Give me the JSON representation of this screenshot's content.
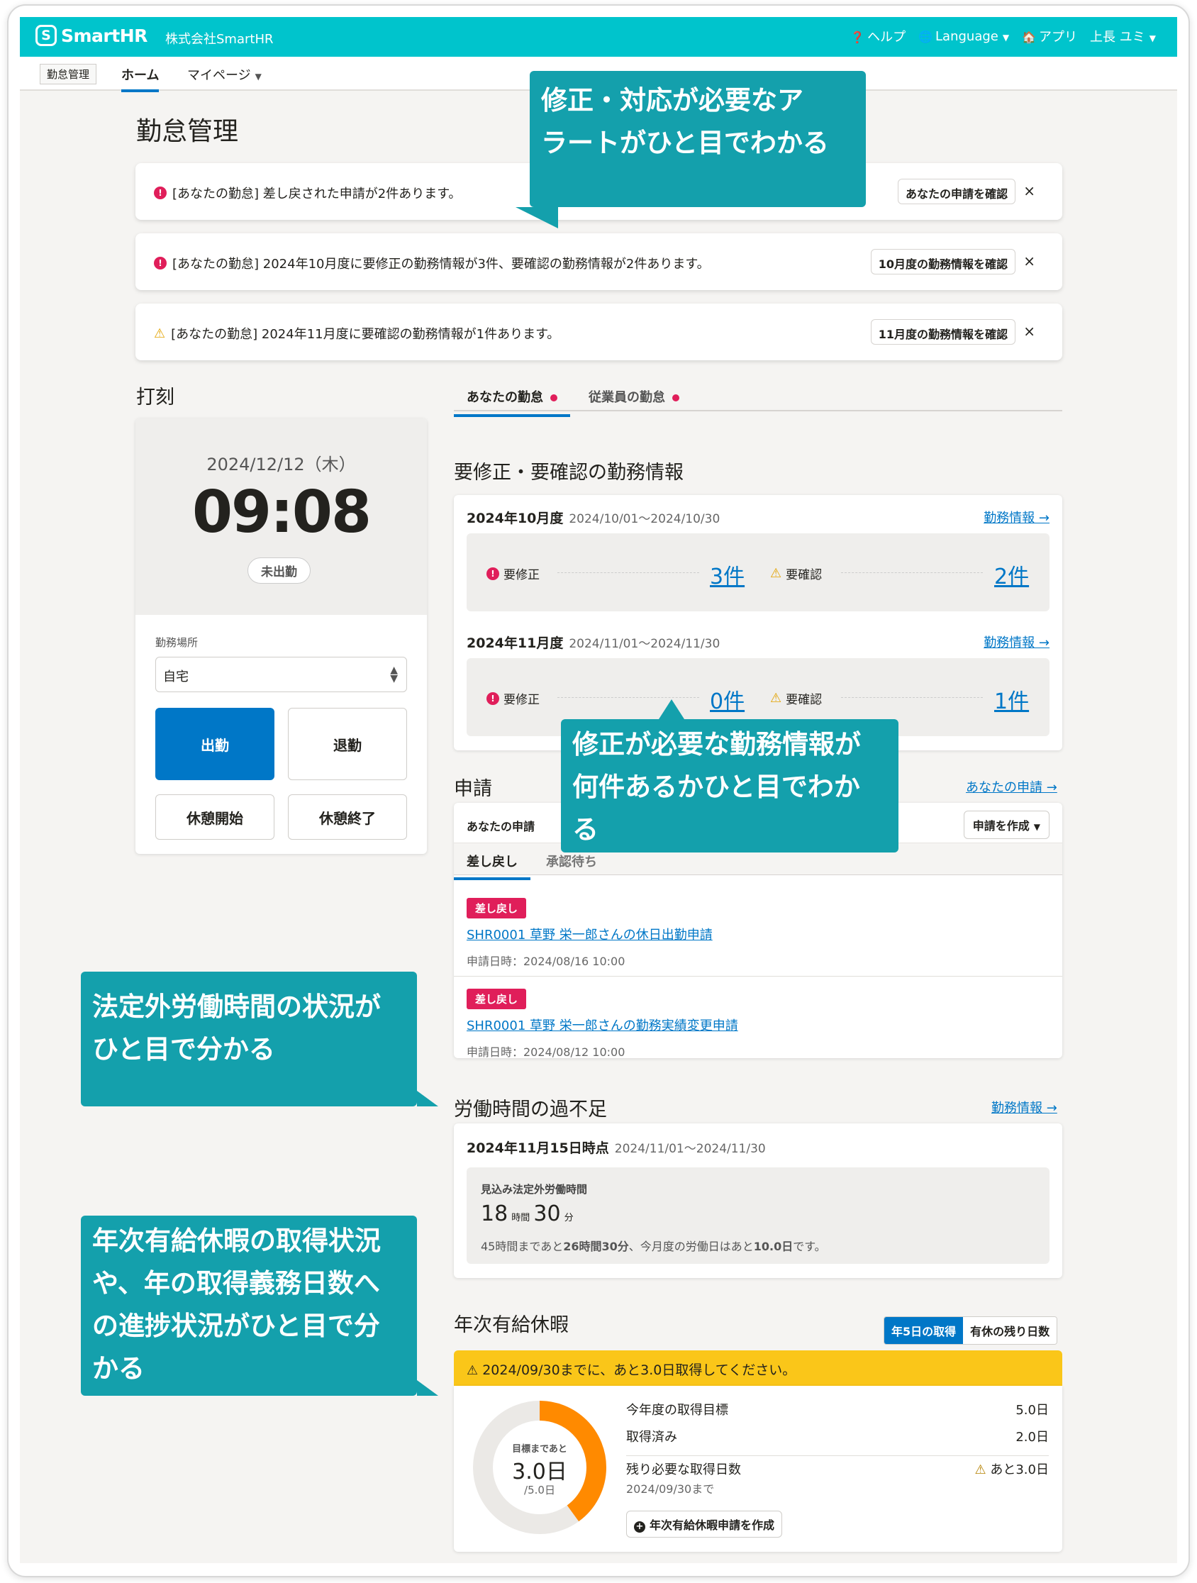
{
  "topbar": {
    "logo_text": "SmartHR",
    "company": "株式会社SmartHR",
    "help": "ヘルプ",
    "language": "Language",
    "apps": "アプリ",
    "user": "上長 ユミ",
    "bg_color": "#00c4cc"
  },
  "subnav": {
    "product": "勤怠管理",
    "home": "ホーム",
    "mypage": "マイページ"
  },
  "page_title": "勤怠管理",
  "alerts": [
    {
      "icon": "error",
      "text": "[あなたの勤怠] 差し戻された申請が2件あります。",
      "button": "あなたの申請を確認",
      "close": "×"
    },
    {
      "icon": "error",
      "text": "[あなたの勤怠] 2024年10月度に要修正の勤務情報が3件、要確認の勤務情報が2件あります。",
      "button": "10月度の勤務情報を確認",
      "close": "×"
    },
    {
      "icon": "warning",
      "text": "[あなたの勤怠] 2024年11月度に要確認の勤務情報が1件あります。",
      "button": "11月度の勤務情報を確認",
      "close": "×"
    }
  ],
  "punch": {
    "title": "打刻",
    "date": "2024/12/12（木）",
    "time": "09:08",
    "status": "未出勤",
    "location_label": "勤務場所",
    "location_value": "自宅",
    "clock_in": "出勤",
    "clock_out": "退勤",
    "break_start": "休憩開始",
    "break_end": "休憩終了"
  },
  "tabs": {
    "mine": "あなたの勤怠",
    "employees": "従業員の勤怠"
  },
  "fix_section": {
    "title": "要修正・要確認の勤務情報",
    "periods": [
      {
        "label": "2024年10月度",
        "range": "2024/10/01〜2024/10/30",
        "link": "勤務情報 →",
        "fix_label": "要修正",
        "fix_count": "3件",
        "check_label": "要確認",
        "check_count": "2件"
      },
      {
        "label": "2024年11月度",
        "range": "2024/11/01〜2024/11/30",
        "link": "勤務情報 →",
        "fix_label": "要修正",
        "fix_count": "0件",
        "check_label": "要確認",
        "check_count": "1件"
      }
    ]
  },
  "requests": {
    "title": "申請",
    "link": "あなたの申請 →",
    "header_label": "あなたの申請",
    "create_button": "申請を作成",
    "tab_returned": "差し戻し",
    "tab_pending": "承認待ち",
    "items": [
      {
        "badge": "差し戻し",
        "title": "SHR0001 草野 栄一郎さんの休日出勤申請",
        "date": "申請日時：2024/08/16 10:00"
      },
      {
        "badge": "差し戻し",
        "title": "SHR0001 草野 栄一郎さんの勤務実績変更申請",
        "date": "申請日時：2024/08/12 10:00"
      }
    ]
  },
  "overtime": {
    "title": "労働時間の過不足",
    "link": "勤務情報 →",
    "as_of": "2024年11月15日時点",
    "range": "2024/11/01〜2024/11/30",
    "box_label": "見込み法定外労働時間",
    "hours": "18",
    "hours_unit": "時間",
    "minutes": "30",
    "minutes_unit": "分",
    "note_pre": "45時間まであと",
    "note_bold1": "26時間30分",
    "note_mid": "、今月度の労働日はあと",
    "note_bold2": "10.0日",
    "note_post": "です。"
  },
  "leave": {
    "title": "年次有給休暇",
    "seg_on": "年5日の取得",
    "seg_off": "有休の残り日数",
    "banner": "2024/09/30までに、あと3.0日取得してください。",
    "donut_label": "目標まであと",
    "donut_value": "3.0日",
    "donut_total": "/5.0日",
    "progress_fraction": 0.4,
    "target_label": "今年度の取得目標",
    "target_value": "5.0日",
    "taken_label": "取得済み",
    "taken_value": "2.0日",
    "remaining_label": "残り必要な取得日数",
    "remaining_value": "あと3.0日",
    "deadline": "2024/09/30まで",
    "create_button": "年次有給休暇申請を作成"
  },
  "callouts": {
    "alerts": [
      "修正・対応が必要なア",
      "ラートがひと目でわかる"
    ],
    "fix": [
      "修正が必要な勤務情報が",
      "何件あるかひと目でわか",
      "る"
    ],
    "overtime": [
      "法定外労働時間の状況が",
      "ひと目で分かる"
    ],
    "leave": [
      " 年次有給休暇の取得状況",
      "や、年の取得義務日数へ",
      "の進捗状況がひと目で分",
      "かる"
    ]
  },
  "colors": {
    "accent": "#0077c7",
    "error": "#e01e5a",
    "warning": "#fac619",
    "callout": "#14a0ac",
    "donut": "#ff8a00"
  }
}
